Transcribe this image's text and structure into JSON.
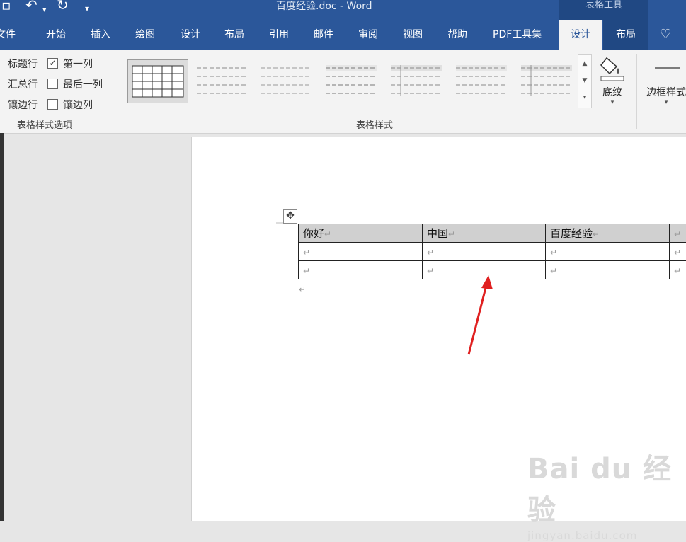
{
  "title_bar": {
    "document_title": "百度经验.doc - Word",
    "context_tab_group": "表格工具"
  },
  "tabs": [
    "文件",
    "开始",
    "插入",
    "绘图",
    "设计",
    "布局",
    "引用",
    "邮件",
    "审阅",
    "视图",
    "帮助",
    "PDF工具集",
    "设计",
    "布局"
  ],
  "active_tab": "设计",
  "style_options": {
    "rows": [
      {
        "label": "标题行",
        "checked": true
      },
      {
        "label": "汇总行",
        "checked": false
      },
      {
        "label": "镶边行",
        "checked": true
      }
    ],
    "cols": [
      {
        "label": "第一列",
        "checked": true
      },
      {
        "label": "最后一列",
        "checked": false
      },
      {
        "label": "镶边列",
        "checked": false
      }
    ],
    "group_label": "表格样式选项"
  },
  "table_styles": {
    "group_label": "表格样式",
    "selected_index": 0
  },
  "shading_button": {
    "label": "底纹"
  },
  "border_styles_button": {
    "label": "边框样式"
  },
  "document_table": {
    "rows": [
      [
        "你好",
        "中国",
        "百度经验",
        ""
      ],
      [
        "",
        "",
        "",
        ""
      ],
      [
        "",
        "",
        "",
        ""
      ]
    ]
  },
  "watermark": {
    "brand": "Bai du 经验",
    "url": "jingyan.baidu.com"
  },
  "colors": {
    "accent": "#2b579a",
    "annotation_arrow": "#e02020"
  }
}
